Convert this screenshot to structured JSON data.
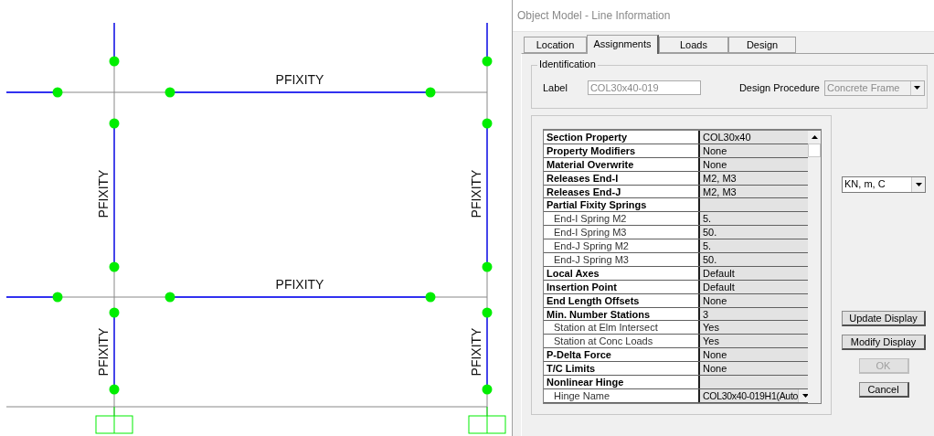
{
  "model": {
    "member_labels": [
      {
        "text": "PFIXITY",
        "kind": "beam"
      },
      {
        "text": "PFIXITY",
        "kind": "column"
      },
      {
        "text": "PFIXITY",
        "kind": "column"
      },
      {
        "text": "PFIXITY",
        "kind": "beam"
      },
      {
        "text": "PFIXITY",
        "kind": "column"
      },
      {
        "text": "PFIXITY",
        "kind": "column"
      }
    ]
  },
  "window": {
    "title": "Object Model - Line Information"
  },
  "tabs": [
    {
      "label": "Location",
      "selected": false
    },
    {
      "label": "Assignments",
      "selected": true
    },
    {
      "label": "Loads",
      "selected": false
    },
    {
      "label": "Design",
      "selected": false
    }
  ],
  "identification": {
    "title": "Identification",
    "label_caption": "Label",
    "label_value": "COL30x40-019",
    "label_disabled": true,
    "design_procedure_caption": "Design Procedure",
    "design_procedure_value": "Concrete Frame",
    "design_procedure_disabled": true
  },
  "property_grid": {
    "rows": [
      {
        "name": "Section Property",
        "value": "COL30x40",
        "kind": "header"
      },
      {
        "name": "Property Modifiers",
        "value": "None",
        "kind": "header"
      },
      {
        "name": "Material Overwrite",
        "value": "None",
        "kind": "header"
      },
      {
        "name": "Releases End-I",
        "value": "M2, M3",
        "kind": "header"
      },
      {
        "name": "Releases End-J",
        "value": "M2, M3",
        "kind": "header"
      },
      {
        "name": "Partial Fixity Springs",
        "kind": "header"
      },
      {
        "name": "End-I Spring M2",
        "value": "5.",
        "kind": "sub"
      },
      {
        "name": "End-I Spring M3",
        "value": "50.",
        "kind": "sub"
      },
      {
        "name": "End-J Spring M2",
        "value": "5.",
        "kind": "sub"
      },
      {
        "name": "End-J Spring M3",
        "value": "50.",
        "kind": "sub"
      },
      {
        "name": "Local Axes",
        "value": "Default",
        "kind": "header"
      },
      {
        "name": "Insertion Point",
        "value": "Default",
        "kind": "header"
      },
      {
        "name": "End Length Offsets",
        "value": "None",
        "kind": "header"
      },
      {
        "name": "Min. Number Stations",
        "value": "3",
        "kind": "header"
      },
      {
        "name": "Station at Elm Intersect",
        "value": "Yes",
        "kind": "sub"
      },
      {
        "name": "Station at Conc Loads",
        "value": "Yes",
        "kind": "sub"
      },
      {
        "name": "P-Delta Force",
        "value": "None",
        "kind": "header"
      },
      {
        "name": "T/C Limits",
        "value": "None",
        "kind": "header"
      },
      {
        "name": "Nonlinear Hinge",
        "kind": "header"
      },
      {
        "name": "Hinge Name",
        "value": "COL30x40-019H1(Auto",
        "kind": "sub",
        "dropdown": true
      }
    ]
  },
  "units": {
    "value": "KN, m, C"
  },
  "buttons": [
    {
      "label": "Update Display",
      "disabled": false,
      "kind": "wide"
    },
    {
      "label": "Modify Display",
      "disabled": false,
      "kind": "wide"
    },
    {
      "label": "OK",
      "disabled": true,
      "kind": "narrow"
    },
    {
      "label": "Cancel",
      "disabled": false,
      "kind": "narrow"
    }
  ]
}
